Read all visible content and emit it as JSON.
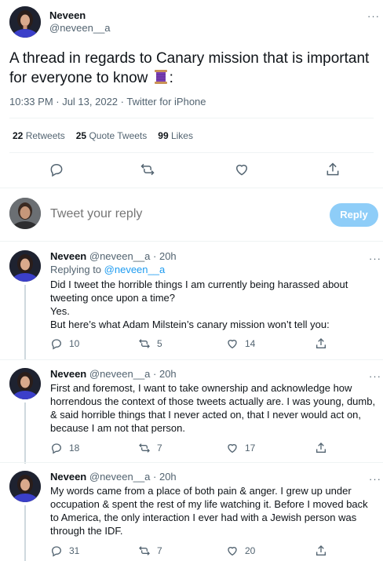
{
  "main_tweet": {
    "author_name": "Neveen",
    "author_handle": "@neveen__a",
    "text": "A thread in regards to Canary mission that is important for everyone to know",
    "text_suffix": ":",
    "emoji": "spool-of-thread-emoji",
    "timestamp": "10:33 PM · Jul 13, 2022 · Twitter for iPhone",
    "stats": [
      {
        "count": "22",
        "label": "Retweets"
      },
      {
        "count": "25",
        "label": "Quote Tweets"
      },
      {
        "count": "99",
        "label": "Likes"
      }
    ],
    "more_label": "···"
  },
  "composer": {
    "placeholder": "Tweet your reply",
    "button_label": "Reply"
  },
  "replies": [
    {
      "author_name": "Neveen",
      "header": "@neveen__a · 20h",
      "replying_to_prefix": "Replying to",
      "replying_to_handle": "@neveen__a",
      "text": "Did I tweet the horrible things I am currently being harassed about tweeting once upon a time?\nYes.\nBut here’s what Adam Milstein’s canary mission won’t tell you:",
      "replies_count": "10",
      "retweets_count": "5",
      "likes_count": "14"
    },
    {
      "author_name": "Neveen",
      "header": "@neveen__a · 20h",
      "text": "First and foremost, I want to take ownership and acknowledge how horrendous the context of those tweets actually are. I was young, dumb, & said horrible things that I never acted on, that I never would act on, because I am not that person.",
      "replies_count": "18",
      "retweets_count": "7",
      "likes_count": "17"
    },
    {
      "author_name": "Neveen",
      "header": "@neveen__a · 20h",
      "text": "My words came from a place of both pain & anger. I grew up under occupation & spent the rest of my life watching it. Before I moved back to America, the only interaction I ever had with a Jewish person was through the IDF.",
      "replies_count": "31",
      "retweets_count": "7",
      "likes_count": "20"
    }
  ],
  "colors": {
    "accent": "#1d9bf0",
    "reply_button": "#8ecdf8",
    "secondary_text": "#536471"
  }
}
